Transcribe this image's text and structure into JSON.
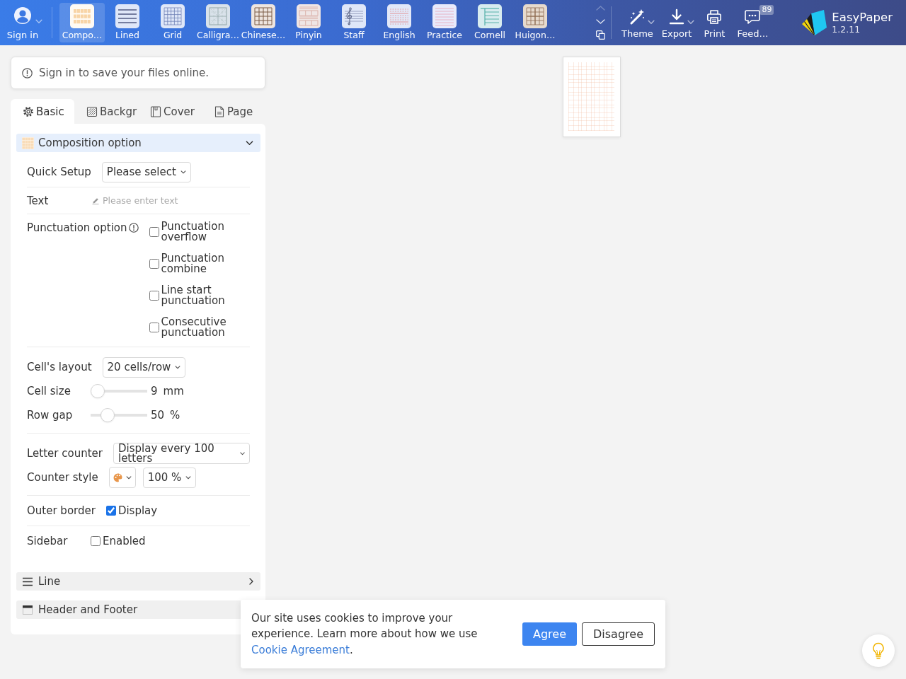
{
  "toolbar": {
    "account": {
      "label": "Sign in",
      "has_menu": true
    },
    "paper_types": [
      {
        "label": "Compo…",
        "kind": "composition",
        "selected": true
      },
      {
        "label": "Lined",
        "kind": "lined",
        "selected": false
      },
      {
        "label": "Grid",
        "kind": "grid",
        "selected": false
      },
      {
        "label": "Calligra…",
        "kind": "calligraphy",
        "selected": false
      },
      {
        "label": "Chinese…",
        "kind": "chinese",
        "selected": false
      },
      {
        "label": "Pinyin",
        "kind": "pinyin",
        "selected": false
      },
      {
        "label": "Staff",
        "kind": "staff",
        "selected": false
      },
      {
        "label": "English",
        "kind": "english",
        "selected": false
      },
      {
        "label": "Practice",
        "kind": "practice",
        "selected": false
      },
      {
        "label": "Cornell",
        "kind": "cornell",
        "selected": false
      },
      {
        "label": "Huigon…",
        "kind": "huigong",
        "selected": false
      }
    ],
    "pager": {
      "up_disabled": true,
      "down_disabled": false
    },
    "actions": [
      {
        "label": "Theme",
        "kind": "theme",
        "has_menu": true
      },
      {
        "label": "Export",
        "kind": "export",
        "has_menu": true
      },
      {
        "label": "Print",
        "kind": "print",
        "has_menu": false
      },
      {
        "label": "Feed…",
        "kind": "feedback",
        "has_menu": false,
        "badge": "89"
      }
    ],
    "brand": {
      "name": "EasyPaper",
      "version": "1.2.11"
    }
  },
  "notice": {
    "text": "Sign in to save your files online."
  },
  "tabs": [
    {
      "label": "Basic",
      "kind": "basic",
      "selected": true
    },
    {
      "label": "Backgr",
      "kind": "background",
      "selected": false
    },
    {
      "label": "Cover",
      "kind": "cover",
      "selected": false
    },
    {
      "label": "Page",
      "kind": "page",
      "selected": false
    }
  ],
  "sections": [
    {
      "title": "Composition option",
      "kind": "composition",
      "expanded": true,
      "groups": [
        {
          "fields": [
            {
              "kind": "select",
              "label": "Quick Setup",
              "value": "Please select"
            }
          ]
        },
        {
          "fields": [
            {
              "kind": "text",
              "label": "Text",
              "placeholder": "Please enter text"
            }
          ]
        },
        {
          "fields": [
            {
              "kind": "checklist",
              "label": "Punctuation option",
              "has_hint": true,
              "options": [
                {
                  "label": "Punctuation overflow",
                  "checked": false
                },
                {
                  "label": "Punctuation combine",
                  "checked": false
                },
                {
                  "label": "Line start punctuation",
                  "checked": false
                },
                {
                  "label": "Consecutive punctuation",
                  "checked": false
                }
              ]
            }
          ]
        },
        {
          "fields": [
            {
              "kind": "select",
              "label": "Cell's layout",
              "value": "20 cells/row"
            },
            {
              "kind": "slider",
              "label": "Cell size",
              "level": 0,
              "value": "9",
              "unit": "mm"
            },
            {
              "kind": "slider",
              "label": "Row gap",
              "level": 0.23,
              "value": "50",
              "unit": "%"
            }
          ]
        },
        {
          "fields": [
            {
              "kind": "select",
              "label": "Letter counter",
              "value": "Display every 100 letters"
            },
            {
              "kind": "style",
              "label": "Counter style",
              "color": "#e8964a",
              "value": "100 %"
            }
          ]
        },
        {
          "fields": [
            {
              "kind": "checkbox",
              "label": "Outer border",
              "option": "Display",
              "checked": true
            }
          ]
        },
        {
          "fields": [
            {
              "kind": "checkbox",
              "label": "Sidebar",
              "option": "Enabled",
              "checked": false
            }
          ]
        }
      ]
    },
    {
      "title": "Line",
      "kind": "line",
      "expanded": false
    },
    {
      "title": "Header and Footer",
      "kind": "header-footer",
      "expanded": false
    }
  ],
  "cookie_banner": {
    "message": "Our site uses cookies to improve your experience. Learn more about how we use",
    "link": "Cookie Agreement",
    "end": ".",
    "buttons": [
      {
        "label": "Agree",
        "kind": "accept"
      },
      {
        "label": "Disagree",
        "kind": "decline"
      }
    ]
  }
}
